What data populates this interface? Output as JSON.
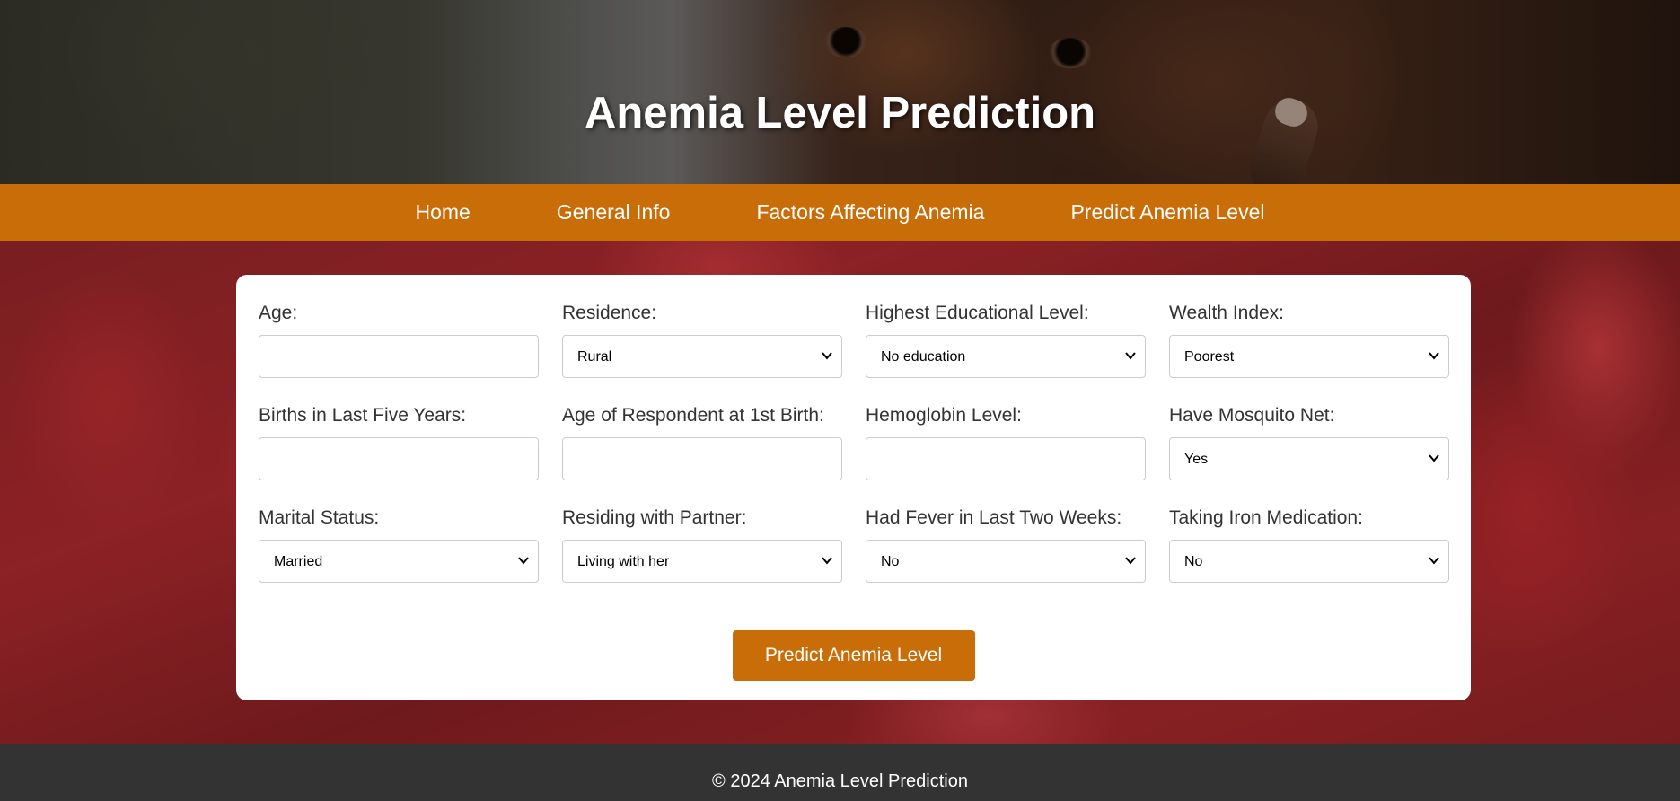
{
  "header": {
    "title": "Anemia Level Prediction"
  },
  "nav": {
    "items": [
      "Home",
      "General Info",
      "Factors Affecting Anemia",
      "Predict Anemia Level"
    ]
  },
  "form": {
    "fields": [
      {
        "label": "Age:",
        "type": "input",
        "value": ""
      },
      {
        "label": "Residence:",
        "type": "select",
        "value": "Rural"
      },
      {
        "label": "Highest Educational Level:",
        "type": "select",
        "value": "No education"
      },
      {
        "label": "Wealth Index:",
        "type": "select",
        "value": "Poorest"
      },
      {
        "label": "Births in Last Five Years:",
        "type": "input",
        "value": ""
      },
      {
        "label": "Age of Respondent at 1st Birth:",
        "type": "input",
        "value": ""
      },
      {
        "label": "Hemoglobin Level:",
        "type": "input",
        "value": ""
      },
      {
        "label": "Have Mosquito Net:",
        "type": "select",
        "value": "Yes"
      },
      {
        "label": "Marital Status:",
        "type": "select",
        "value": "Married"
      },
      {
        "label": "Residing with Partner:",
        "type": "select",
        "value": "Living with her"
      },
      {
        "label": "Had Fever in Last Two Weeks:",
        "type": "select",
        "value": "No"
      },
      {
        "label": "Taking Iron Medication:",
        "type": "select",
        "value": "No"
      }
    ],
    "submit_label": "Predict Anemia Level"
  },
  "footer": {
    "text": "© 2024 Anemia Level Prediction"
  },
  "colors": {
    "accent": "#c86d08",
    "footer": "#333333"
  }
}
